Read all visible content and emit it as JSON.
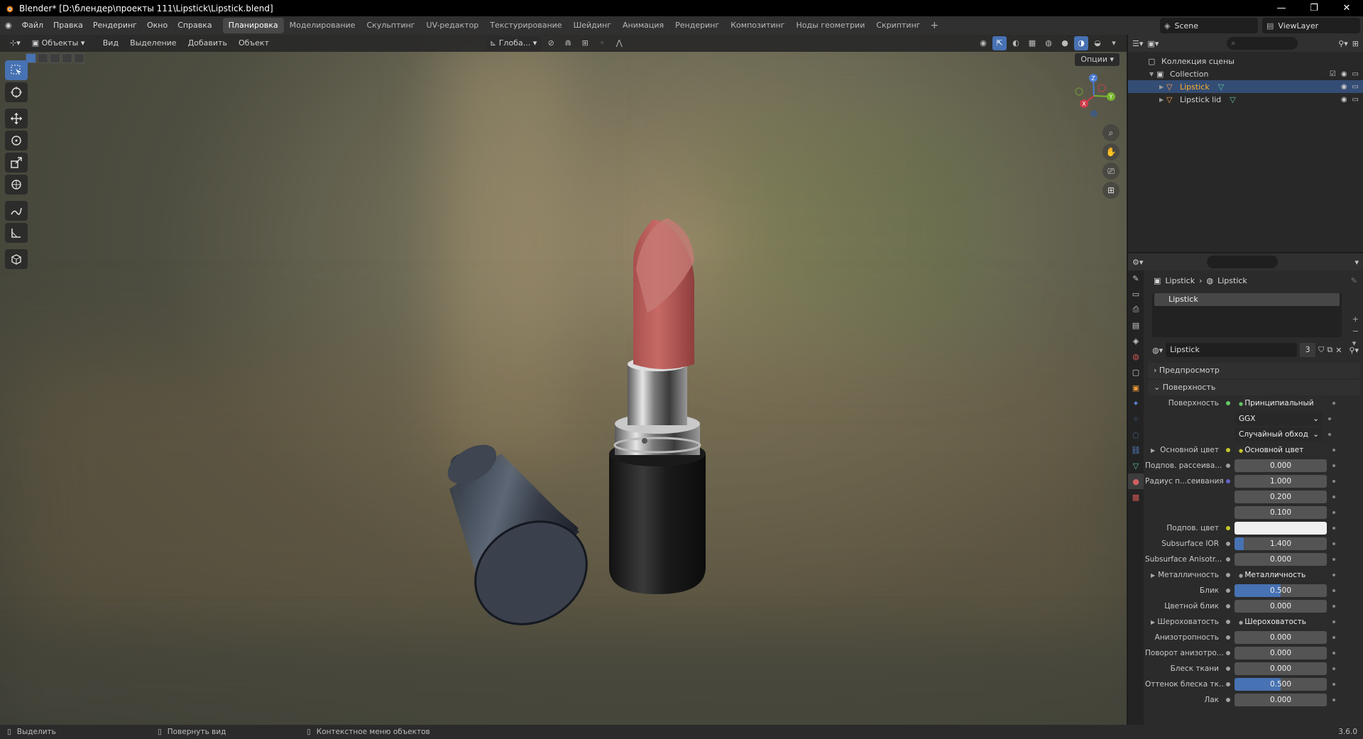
{
  "titlebar": {
    "title": "Blender* [D:\\блендер\\проекты 111\\Lipstick\\Lipstick.blend]",
    "minimize": "—",
    "maximize": "❐",
    "close": "✕"
  },
  "menu": {
    "items": [
      "Файл",
      "Правка",
      "Рендеринг",
      "Окно",
      "Справка"
    ],
    "workspaces": [
      "Планировка",
      "Моделирование",
      "Скульптинг",
      "UV-редактор",
      "Текстурирование",
      "Шейдинг",
      "Анимация",
      "Рендеринг",
      "Композитинг",
      "Ноды геометрии",
      "Скриптинг"
    ],
    "active_workspace": "Планировка",
    "add": "+",
    "scene": "Scene",
    "view_layer": "ViewLayer"
  },
  "viewport": {
    "mode": "Объекты",
    "menus": [
      "Вид",
      "Выделение",
      "Добавить",
      "Объект"
    ],
    "transform_orientation": "Глоба...",
    "options": "Опции",
    "gizmo_axes": {
      "z": "Z",
      "y": "Y",
      "x": "X"
    }
  },
  "outliner": {
    "root": "Коллекция сцены",
    "collection": "Collection",
    "objects": [
      {
        "name": "Lipstick",
        "selected": true
      },
      {
        "name": "Lipstick lid",
        "selected": false
      }
    ]
  },
  "properties": {
    "breadcrumb": [
      "Lipstick",
      "Lipstick"
    ],
    "slot": "Lipstick",
    "material_name": "Lipstick",
    "users": "3",
    "panels": {
      "preview": "Предпросмотр",
      "surface": "Поверхность"
    },
    "rows": [
      {
        "label": "Поверхность",
        "value": "Принципиальный BSDF",
        "kind": "dark",
        "socket": "#63c763"
      },
      {
        "label": "",
        "value": "GGX",
        "kind": "sel",
        "socket": ""
      },
      {
        "label": "",
        "value": "Случайный обход",
        "kind": "sel",
        "socket": ""
      },
      {
        "label": "Основной цвет",
        "value": "Основной цвет",
        "kind": "dark",
        "socket": "#c7c729",
        "expand": true
      },
      {
        "label": "Подпов. рассеива...",
        "value": "0.000",
        "kind": "num",
        "socket": "#a1a1a1"
      },
      {
        "label": "Радиус п...сеивания",
        "value": "1.000",
        "kind": "num",
        "socket": "#6363c7"
      },
      {
        "label": "",
        "value": "0.200",
        "kind": "num",
        "socket": ""
      },
      {
        "label": "",
        "value": "0.100",
        "kind": "num",
        "socket": ""
      },
      {
        "label": "Подпов. цвет",
        "value": "",
        "kind": "color",
        "socket": "#c7c729"
      },
      {
        "label": "Subsurface IOR",
        "value": "1.400",
        "kind": "num",
        "socket": "#a1a1a1",
        "fill": 0.1
      },
      {
        "label": "Subsurface Anisotr...",
        "value": "0.000",
        "kind": "num",
        "socket": "#a1a1a1"
      },
      {
        "label": "Металличность",
        "value": "Металличность",
        "kind": "dark",
        "socket": "#a1a1a1",
        "expand": true
      },
      {
        "label": "Блик",
        "value": "0.500",
        "kind": "num",
        "socket": "#a1a1a1",
        "fill": 0.5
      },
      {
        "label": "Цветной блик",
        "value": "0.000",
        "kind": "num",
        "socket": "#a1a1a1"
      },
      {
        "label": "Шероховатость",
        "value": "Шероховатость",
        "kind": "dark",
        "socket": "#a1a1a1",
        "expand": true
      },
      {
        "label": "Анизотропность",
        "value": "0.000",
        "kind": "num",
        "socket": "#a1a1a1"
      },
      {
        "label": "Поворот анизотро...",
        "value": "0.000",
        "kind": "num",
        "socket": "#a1a1a1"
      },
      {
        "label": "Блеск ткани",
        "value": "0.000",
        "kind": "num",
        "socket": "#a1a1a1"
      },
      {
        "label": "Оттенок блеска тк...",
        "value": "0.500",
        "kind": "num",
        "socket": "#a1a1a1",
        "fill": 0.5
      },
      {
        "label": "Лак",
        "value": "0.000",
        "kind": "num",
        "socket": "#a1a1a1"
      }
    ]
  },
  "status": {
    "select": "Выделить",
    "rotate": "Повернуть вид",
    "context": "Контекстное меню объектов",
    "version": "3.6.0"
  },
  "colors": {
    "accent": "#4772b3",
    "selection_text": "#ffaf29"
  }
}
